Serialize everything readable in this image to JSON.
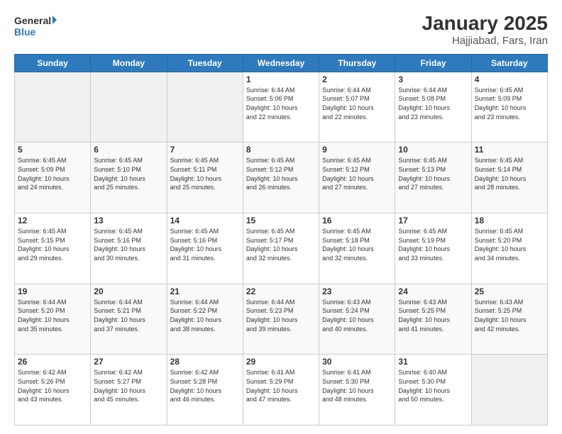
{
  "header": {
    "logo_line1": "General",
    "logo_line2": "Blue",
    "title": "January 2025",
    "subtitle": "Hajjiabad, Fars, Iran"
  },
  "days_of_week": [
    "Sunday",
    "Monday",
    "Tuesday",
    "Wednesday",
    "Thursday",
    "Friday",
    "Saturday"
  ],
  "weeks": [
    [
      {
        "day": "",
        "info": ""
      },
      {
        "day": "",
        "info": ""
      },
      {
        "day": "",
        "info": ""
      },
      {
        "day": "1",
        "info": "Sunrise: 6:44 AM\nSunset: 5:06 PM\nDaylight: 10 hours\nand 22 minutes."
      },
      {
        "day": "2",
        "info": "Sunrise: 6:44 AM\nSunset: 5:07 PM\nDaylight: 10 hours\nand 22 minutes."
      },
      {
        "day": "3",
        "info": "Sunrise: 6:44 AM\nSunset: 5:08 PM\nDaylight: 10 hours\nand 23 minutes."
      },
      {
        "day": "4",
        "info": "Sunrise: 6:45 AM\nSunset: 5:09 PM\nDaylight: 10 hours\nand 23 minutes."
      }
    ],
    [
      {
        "day": "5",
        "info": "Sunrise: 6:45 AM\nSunset: 5:09 PM\nDaylight: 10 hours\nand 24 minutes."
      },
      {
        "day": "6",
        "info": "Sunrise: 6:45 AM\nSunset: 5:10 PM\nDaylight: 10 hours\nand 25 minutes."
      },
      {
        "day": "7",
        "info": "Sunrise: 6:45 AM\nSunset: 5:11 PM\nDaylight: 10 hours\nand 25 minutes."
      },
      {
        "day": "8",
        "info": "Sunrise: 6:45 AM\nSunset: 5:12 PM\nDaylight: 10 hours\nand 26 minutes."
      },
      {
        "day": "9",
        "info": "Sunrise: 6:45 AM\nSunset: 5:12 PM\nDaylight: 10 hours\nand 27 minutes."
      },
      {
        "day": "10",
        "info": "Sunrise: 6:45 AM\nSunset: 5:13 PM\nDaylight: 10 hours\nand 27 minutes."
      },
      {
        "day": "11",
        "info": "Sunrise: 6:45 AM\nSunset: 5:14 PM\nDaylight: 10 hours\nand 28 minutes."
      }
    ],
    [
      {
        "day": "12",
        "info": "Sunrise: 6:45 AM\nSunset: 5:15 PM\nDaylight: 10 hours\nand 29 minutes."
      },
      {
        "day": "13",
        "info": "Sunrise: 6:45 AM\nSunset: 5:16 PM\nDaylight: 10 hours\nand 30 minutes."
      },
      {
        "day": "14",
        "info": "Sunrise: 6:45 AM\nSunset: 5:16 PM\nDaylight: 10 hours\nand 31 minutes."
      },
      {
        "day": "15",
        "info": "Sunrise: 6:45 AM\nSunset: 5:17 PM\nDaylight: 10 hours\nand 32 minutes."
      },
      {
        "day": "16",
        "info": "Sunrise: 6:45 AM\nSunset: 5:18 PM\nDaylight: 10 hours\nand 32 minutes."
      },
      {
        "day": "17",
        "info": "Sunrise: 6:45 AM\nSunset: 5:19 PM\nDaylight: 10 hours\nand 33 minutes."
      },
      {
        "day": "18",
        "info": "Sunrise: 6:45 AM\nSunset: 5:20 PM\nDaylight: 10 hours\nand 34 minutes."
      }
    ],
    [
      {
        "day": "19",
        "info": "Sunrise: 6:44 AM\nSunset: 5:20 PM\nDaylight: 10 hours\nand 35 minutes."
      },
      {
        "day": "20",
        "info": "Sunrise: 6:44 AM\nSunset: 5:21 PM\nDaylight: 10 hours\nand 37 minutes."
      },
      {
        "day": "21",
        "info": "Sunrise: 6:44 AM\nSunset: 5:22 PM\nDaylight: 10 hours\nand 38 minutes."
      },
      {
        "day": "22",
        "info": "Sunrise: 6:44 AM\nSunset: 5:23 PM\nDaylight: 10 hours\nand 39 minutes."
      },
      {
        "day": "23",
        "info": "Sunrise: 6:43 AM\nSunset: 5:24 PM\nDaylight: 10 hours\nand 40 minutes."
      },
      {
        "day": "24",
        "info": "Sunrise: 6:43 AM\nSunset: 5:25 PM\nDaylight: 10 hours\nand 41 minutes."
      },
      {
        "day": "25",
        "info": "Sunrise: 6:43 AM\nSunset: 5:25 PM\nDaylight: 10 hours\nand 42 minutes."
      }
    ],
    [
      {
        "day": "26",
        "info": "Sunrise: 6:42 AM\nSunset: 5:26 PM\nDaylight: 10 hours\nand 43 minutes."
      },
      {
        "day": "27",
        "info": "Sunrise: 6:42 AM\nSunset: 5:27 PM\nDaylight: 10 hours\nand 45 minutes."
      },
      {
        "day": "28",
        "info": "Sunrise: 6:42 AM\nSunset: 5:28 PM\nDaylight: 10 hours\nand 46 minutes."
      },
      {
        "day": "29",
        "info": "Sunrise: 6:41 AM\nSunset: 5:29 PM\nDaylight: 10 hours\nand 47 minutes."
      },
      {
        "day": "30",
        "info": "Sunrise: 6:41 AM\nSunset: 5:30 PM\nDaylight: 10 hours\nand 48 minutes."
      },
      {
        "day": "31",
        "info": "Sunrise: 6:40 AM\nSunset: 5:30 PM\nDaylight: 10 hours\nand 50 minutes."
      },
      {
        "day": "",
        "info": ""
      }
    ]
  ]
}
